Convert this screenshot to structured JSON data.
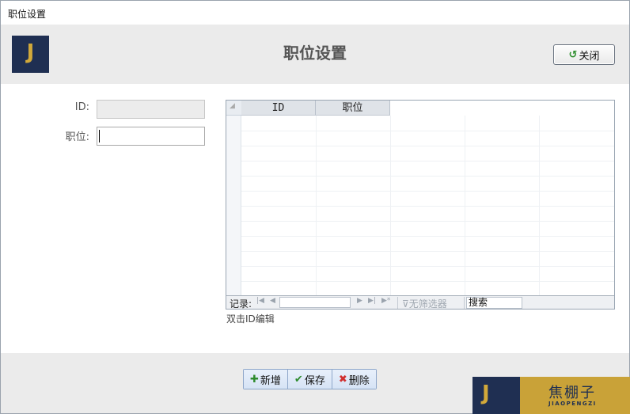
{
  "window": {
    "title": "职位设置"
  },
  "header": {
    "logo_letter": "J",
    "page_title": "职位设置",
    "close_button": {
      "label": "关闭",
      "icon": "undo-arrow-icon"
    }
  },
  "form": {
    "id_label": "ID:",
    "id_value": "",
    "position_label": "职位:",
    "position_value": ""
  },
  "grid": {
    "columns": [
      "ID",
      "职位"
    ],
    "rows": [],
    "navigator": {
      "records_label": "记录:",
      "filter_label": "无筛选器",
      "search_placeholder": "搜索"
    }
  },
  "hint": "双击ID编辑",
  "footer": {
    "buttons": [
      {
        "label": "新增",
        "icon": "add-icon",
        "color": "#2e8b2e"
      },
      {
        "label": "保存",
        "icon": "check-icon",
        "color": "#2e8b2e"
      },
      {
        "label": "删除",
        "icon": "delete-x-icon",
        "color": "#d03030"
      }
    ],
    "brand": {
      "letter": "J",
      "name": "焦棚子",
      "pinyin": "JIAOPENGZI"
    }
  },
  "colors": {
    "navy": "#1f2f52",
    "gold": "#c9a238",
    "header_bg": "#ebebeb"
  }
}
